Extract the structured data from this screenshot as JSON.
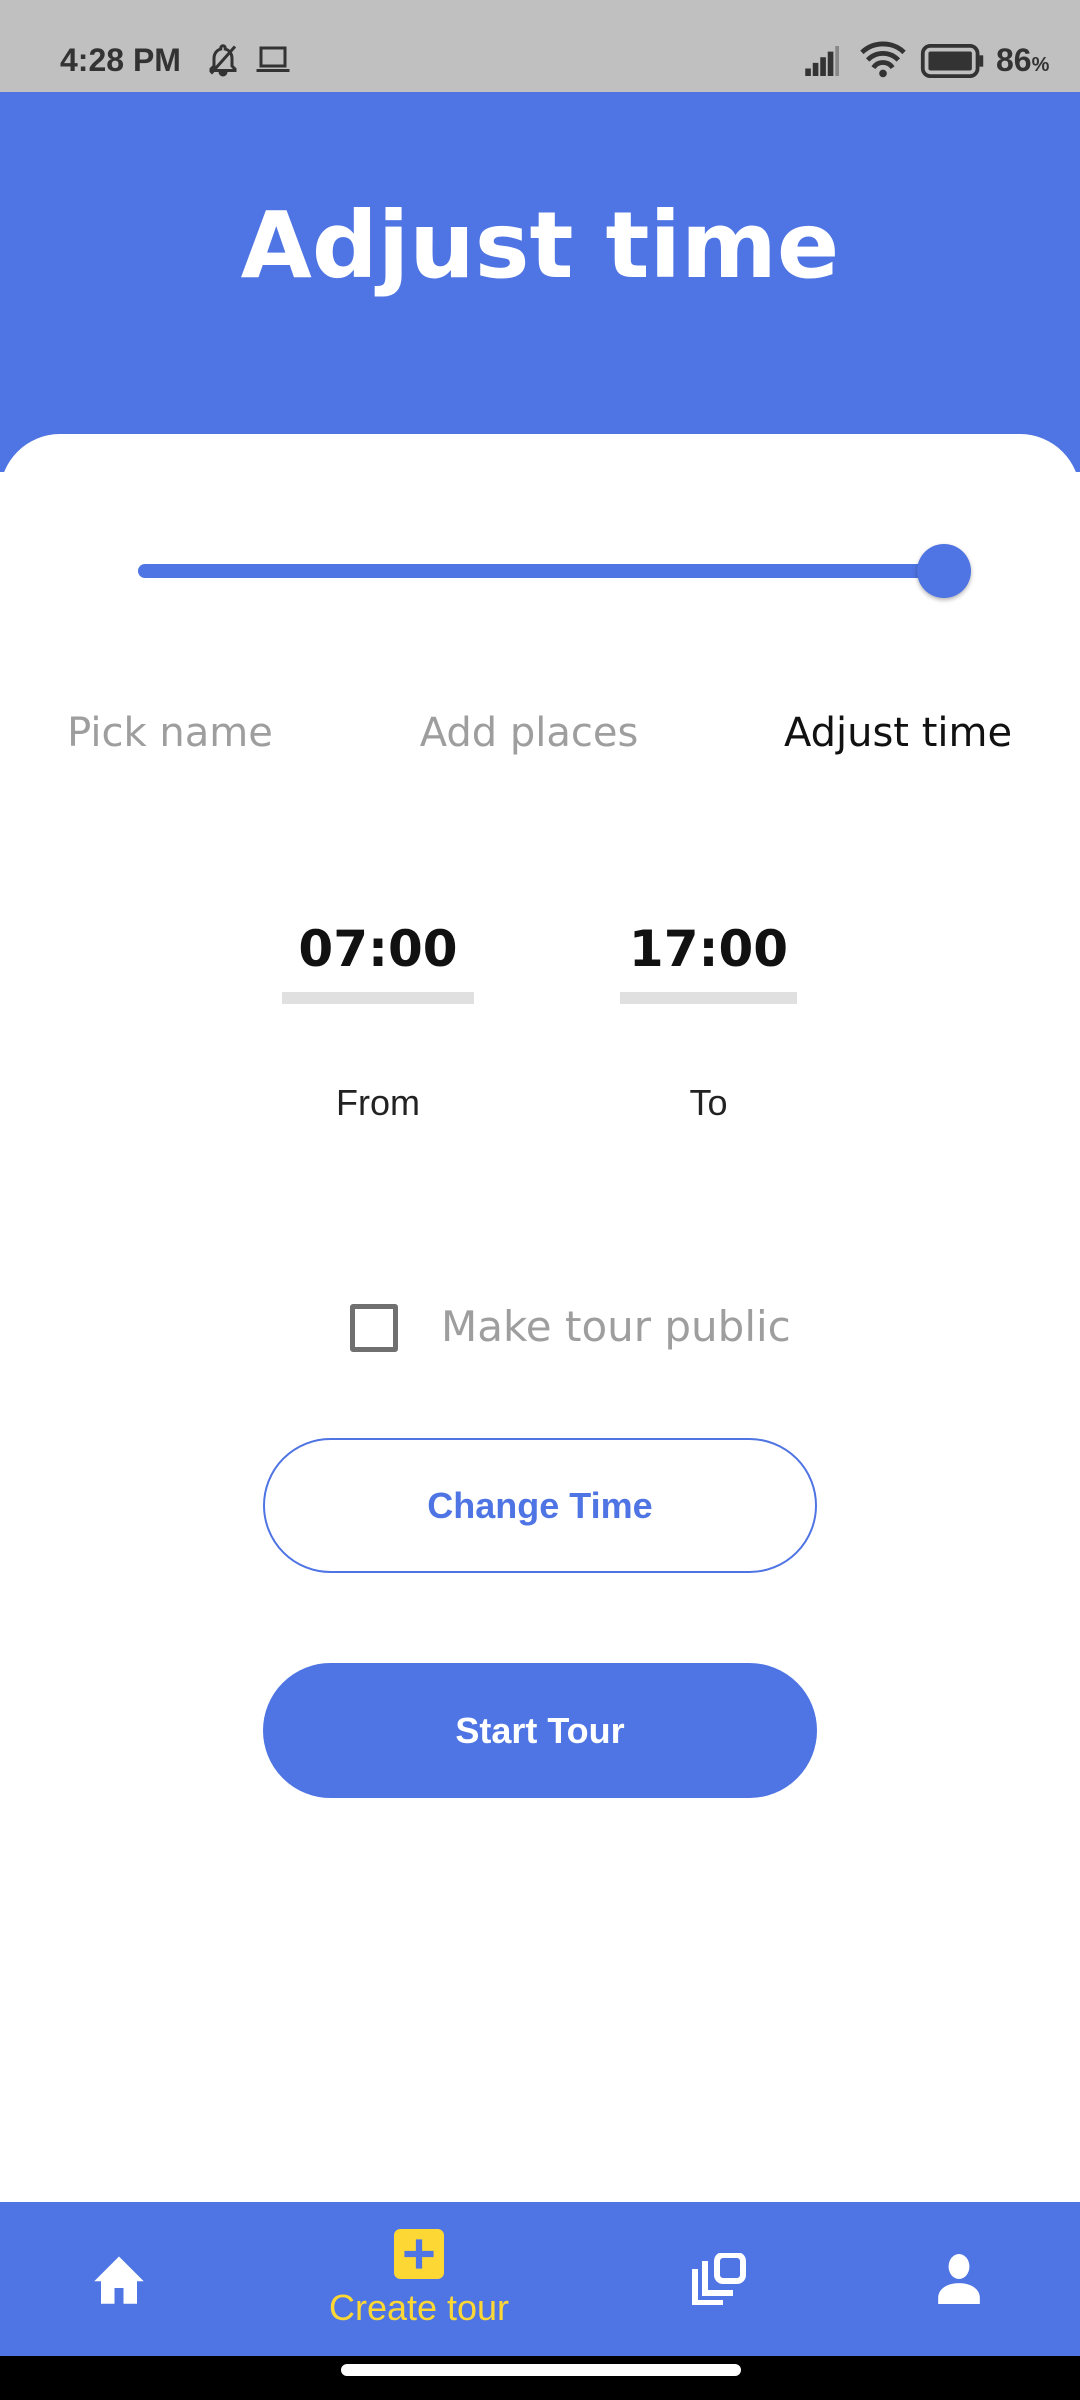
{
  "status_bar": {
    "time": "4:28 PM",
    "battery": "86",
    "battery_unit": "%"
  },
  "header": {
    "title": "Adjust time"
  },
  "progress": {
    "value_percent": 100
  },
  "steps": [
    {
      "label": "Pick name",
      "active": false
    },
    {
      "label": "Add places",
      "active": false
    },
    {
      "label": "Adjust time",
      "active": true
    }
  ],
  "time_range": {
    "from_value": "07:00",
    "from_label": "From",
    "to_value": "17:00",
    "to_label": "To"
  },
  "public_checkbox": {
    "label": "Make tour public",
    "checked": false
  },
  "buttons": {
    "change_time": "Change Time",
    "start_tour": "Start Tour"
  },
  "bottom_nav": {
    "items": [
      {
        "icon": "home-icon"
      },
      {
        "icon": "add-box-icon",
        "label": "Create tour",
        "active": true
      },
      {
        "icon": "library-icon"
      },
      {
        "icon": "person-icon"
      }
    ]
  },
  "colors": {
    "primary": "#4f74e3",
    "active_nav": "#fdd835",
    "inactive_step": "#9e9e9e"
  }
}
